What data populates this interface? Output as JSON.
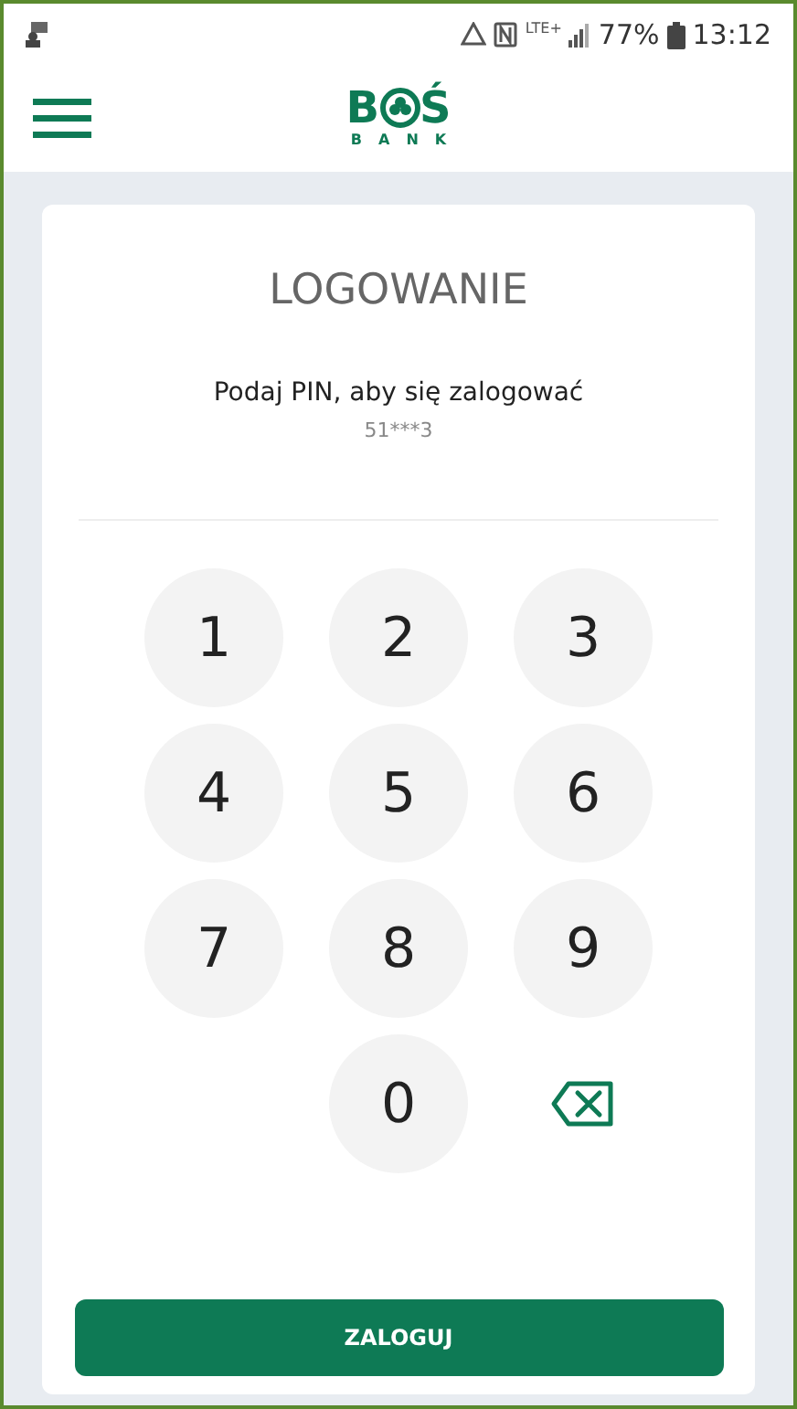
{
  "status_bar": {
    "network": "LTE+",
    "battery": "77%",
    "time": "13:12"
  },
  "header": {
    "logo_left": "B",
    "logo_right": "Ś",
    "logo_sub": "BANK"
  },
  "card": {
    "title": "LOGOWANIE",
    "prompt": "Podaj PIN, aby się zalogować",
    "account": "51***3"
  },
  "keypad": [
    {
      "kind": "digit",
      "label": "1"
    },
    {
      "kind": "digit",
      "label": "2"
    },
    {
      "kind": "digit",
      "label": "3"
    },
    {
      "kind": "digit",
      "label": "4"
    },
    {
      "kind": "digit",
      "label": "5"
    },
    {
      "kind": "digit",
      "label": "6"
    },
    {
      "kind": "digit",
      "label": "7"
    },
    {
      "kind": "digit",
      "label": "8"
    },
    {
      "kind": "digit",
      "label": "9"
    },
    {
      "kind": "empty"
    },
    {
      "kind": "digit",
      "label": "0"
    },
    {
      "kind": "backspace"
    }
  ],
  "login_button": "ZALOGUJ"
}
